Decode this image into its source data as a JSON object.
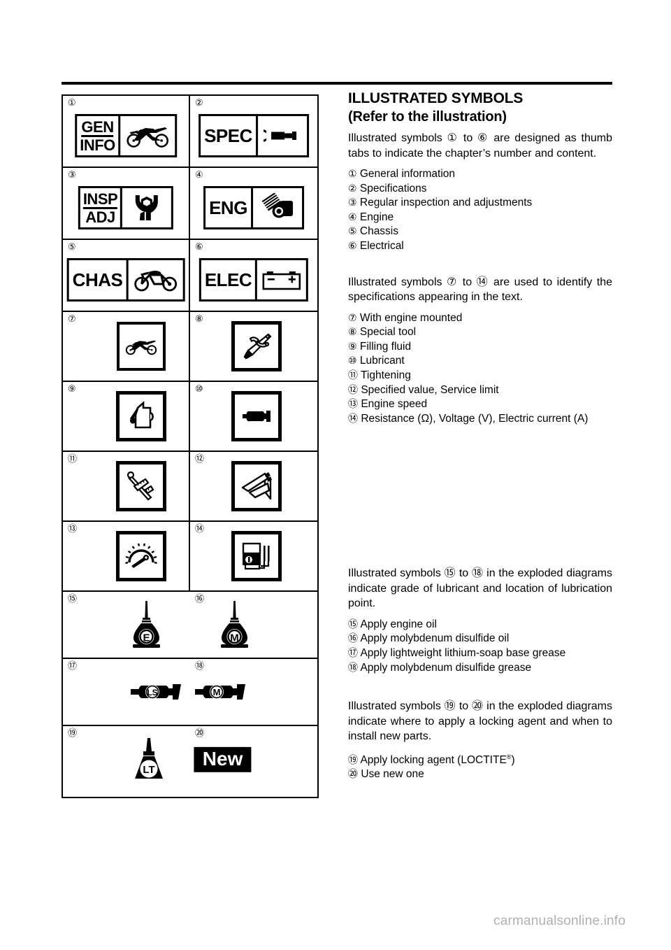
{
  "document": {
    "watermark": "carmanualsonline.info"
  },
  "content": {
    "title": "ILLUSTRATED SYMBOLS",
    "subtitle": "(Refer to the illustration)",
    "paragraph_1": "Illustrated symbols ① to ⑥ are designed as thumb tabs to indicate the chapter’s number and content.",
    "paragraph_2": "Illustrated symbols ⑦ to ⑭ are used to identify the specifications appearing in the text.",
    "paragraph_3": "Illustrated symbols ⑮ to ⑱ in the exploded diagrams indicate grade of lubricant and location of lubrication point.",
    "paragraph_4": "Illustrated symbols ⑲ to ⑳ in the exploded diagrams indicate where to apply a locking agent and when to install new parts.",
    "list_1": [
      {
        "marker": "①",
        "text": "General information"
      },
      {
        "marker": "②",
        "text": "Specifications"
      },
      {
        "marker": "③",
        "text": "Regular inspection and adjustments"
      },
      {
        "marker": "④",
        "text": "Engine"
      },
      {
        "marker": "⑤",
        "text": "Chassis"
      },
      {
        "marker": "⑥",
        "text": "Electrical"
      }
    ],
    "list_2": [
      {
        "marker": "⑦",
        "text": "With engine mounted"
      },
      {
        "marker": "⑧",
        "text": "Special tool"
      },
      {
        "marker": "⑨",
        "text": "Filling fluid"
      },
      {
        "marker": "⑩",
        "text": "Lubricant"
      },
      {
        "marker": "⑪",
        "text": "Tightening"
      },
      {
        "marker": "⑫",
        "text": "Specified value, Service limit"
      },
      {
        "marker": "⑬",
        "text": "Engine speed"
      },
      {
        "marker": "⑭",
        "text": "Resistance (Ω), Voltage (V), Electric current (A)"
      }
    ],
    "list_3": [
      {
        "marker": "⑮",
        "text": "Apply engine oil"
      },
      {
        "marker": "⑯",
        "text": "Apply molybdenum disulfide oil"
      },
      {
        "marker": "⑰",
        "text": "Apply lightweight lithium-soap base grease"
      },
      {
        "marker": "⑱",
        "text": "Apply molybdenum disulfide grease"
      }
    ],
    "list_4": [
      {
        "marker": "⑲",
        "text_before": "Apply locking agent (LOCTITE",
        "superscript": "®",
        "text_after": ")"
      },
      {
        "marker": "⑳",
        "text": "Use new one"
      }
    ]
  },
  "illustration": {
    "thumb_tabs": [
      {
        "marker": "①",
        "label_lines": [
          "GEN",
          "INFO"
        ],
        "icon": "motorcycle-offroad-icon"
      },
      {
        "marker": "②",
        "label_lines": [
          "SPEC"
        ],
        "icon": "micrometer-icon"
      },
      {
        "marker": "③",
        "label_lines": [
          "INSP",
          "ADJ"
        ],
        "icon": "wrench-nut-icon"
      },
      {
        "marker": "④",
        "label_lines": [
          "ENG"
        ],
        "icon": "piston-crank-icon"
      },
      {
        "marker": "⑤",
        "label_lines": [
          "CHAS"
        ],
        "icon": "motorcycle-frame-icon"
      },
      {
        "marker": "⑥",
        "label_lines": [
          "ELEC"
        ],
        "icon": "battery-icon",
        "battery_minus": "−",
        "battery_plus": "+"
      }
    ],
    "spec_symbols": [
      {
        "marker": "⑦",
        "icon": "motorcycle-engine-mounted-icon"
      },
      {
        "marker": "⑧",
        "icon": "special-tool-icon"
      },
      {
        "marker": "⑨",
        "icon": "oil-can-drop-icon"
      },
      {
        "marker": "⑩",
        "icon": "grease-gun-lubricant-icon"
      },
      {
        "marker": "⑪",
        "icon": "torque-wrench-icon"
      },
      {
        "marker": "⑫",
        "icon": "vernier-caliper-icon"
      },
      {
        "marker": "⑬",
        "icon": "tachometer-gauge-icon"
      },
      {
        "marker": "⑭",
        "icon": "multimeter-icon"
      }
    ],
    "lubricant_symbols": [
      {
        "marker": "⑮",
        "icon": "oil-bottle-icon",
        "code": "E"
      },
      {
        "marker": "⑯",
        "icon": "oil-bottle-icon",
        "code": "M"
      },
      {
        "marker": "⑰",
        "icon": "grease-gun-icon",
        "code": "LS"
      },
      {
        "marker": "⑱",
        "icon": "grease-gun-icon",
        "code": "M"
      }
    ],
    "locking_symbols": [
      {
        "marker": "⑲",
        "icon": "locking-agent-bottle-icon",
        "code": "LT"
      },
      {
        "marker": "⑳",
        "icon": "new-part-label",
        "code": "New"
      }
    ]
  },
  "colors": {
    "ink": "#000000",
    "paper": "#ffffff",
    "watermark": "#b0b0b0"
  }
}
